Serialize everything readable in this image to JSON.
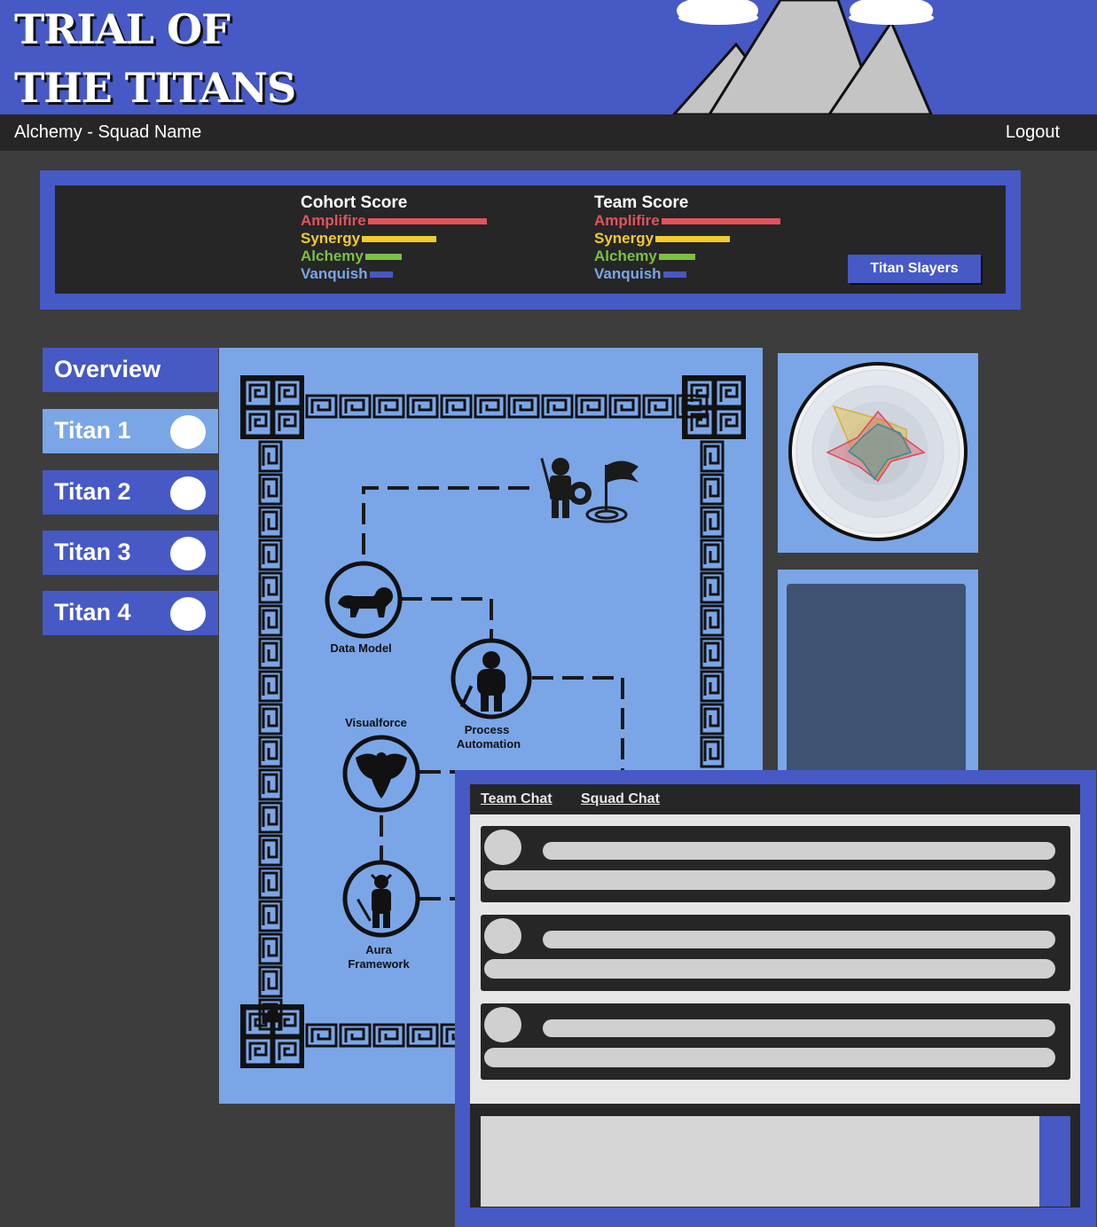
{
  "header": {
    "title_line1": "TRIAL OF",
    "title_line2": "THE TITANS"
  },
  "subbar": {
    "squad_label": "Alchemy - Squad Name",
    "logout_label": "Logout"
  },
  "scores": {
    "cohort": {
      "title": "Cohort Score",
      "rows": [
        {
          "label": "Amplifire",
          "value": 0.56,
          "color": "#e0545c"
        },
        {
          "label": "Synergy",
          "value": 0.35,
          "color": "#f2cb2c"
        },
        {
          "label": "Alchemy",
          "value": 0.17,
          "color": "#7bbf44"
        },
        {
          "label": "Vanquish",
          "value": 0.11,
          "color": "#4659c5"
        }
      ]
    },
    "team": {
      "title": "Team Score",
      "rows": [
        {
          "label": "Amplifire",
          "value": 0.56,
          "color": "#e0545c"
        },
        {
          "label": "Synergy",
          "value": 0.35,
          "color": "#f2cb2c"
        },
        {
          "label": "Alchemy",
          "value": 0.17,
          "color": "#7bbf44"
        },
        {
          "label": "Vanquish",
          "value": 0.11,
          "color": "#4659c5"
        }
      ]
    },
    "label_colors": {
      "Amplifire": "#e0545c",
      "Synergy": "#f2cb2c",
      "Alchemy": "#7bbf44",
      "Vanquish": "#7aa6e8"
    },
    "team_button": "Titan Slayers"
  },
  "nav": {
    "items": [
      {
        "label": "Overview",
        "active": false,
        "has_status": false
      },
      {
        "label": "Titan 1",
        "active": true,
        "has_status": true
      },
      {
        "label": "Titan 2",
        "active": false,
        "has_status": true
      },
      {
        "label": "Titan 3",
        "active": false,
        "has_status": true
      },
      {
        "label": "Titan 4",
        "active": false,
        "has_status": true
      }
    ]
  },
  "map": {
    "nodes": [
      {
        "label": "Data Model",
        "icon": "lion-icon"
      },
      {
        "label_lines": [
          "Process",
          "Automation"
        ],
        "icon": "cyclops-icon"
      },
      {
        "label": "Visualforce",
        "icon": "harpy-icon"
      },
      {
        "label_lines": [
          "Aura",
          "Framework"
        ],
        "icon": "minotaur-icon"
      }
    ],
    "goal_icon": "spartan-flag-icon"
  },
  "chat": {
    "tabs": [
      "Team Chat",
      "Squad Chat"
    ],
    "message_count": 3
  },
  "colors": {
    "brand_blue": "#4659c5",
    "light_blue": "#7aa6e8",
    "dark": "#262626",
    "background": "#3d3d3d"
  }
}
